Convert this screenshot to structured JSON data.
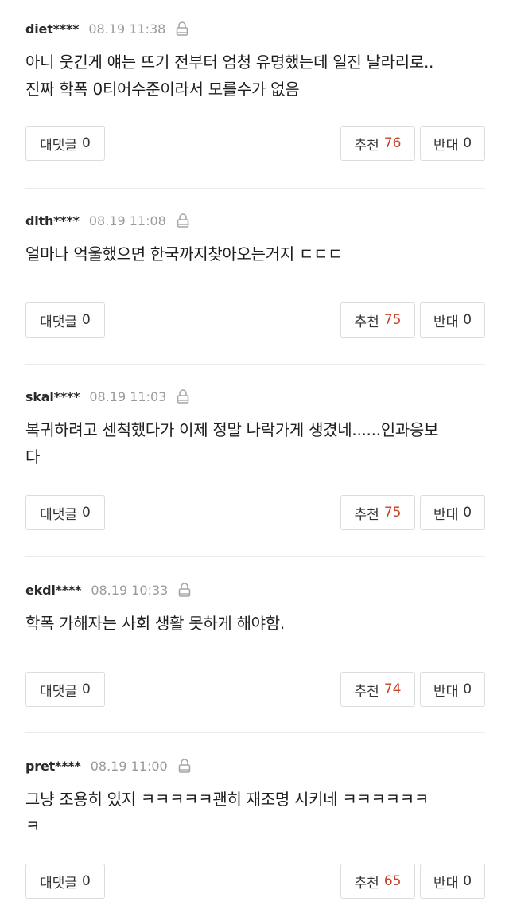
{
  "comments": [
    {
      "author": "diet****",
      "date": "08.19 11:38",
      "lines": [
        "아니 웃긴게 얘는 뜨기 전부터 엄청 유명했는데 일진 날라리로..",
        "진짜 학폭 0티어수준이라서 모를수가 없음"
      ],
      "reply_label": "대댓글",
      "reply_count": "0",
      "recommend_label": "추천",
      "recommend_count": "76",
      "oppose_label": "반대",
      "oppose_count": "0"
    },
    {
      "author": "dlth****",
      "date": "08.19 11:08",
      "lines": [
        "얼마나 억울했으면 한국까지찾아오는거지 ㄷㄷㄷ"
      ],
      "reply_label": "대댓글",
      "reply_count": "0",
      "recommend_label": "추천",
      "recommend_count": "75",
      "oppose_label": "반대",
      "oppose_count": "0"
    },
    {
      "author": "skal****",
      "date": "08.19 11:03",
      "lines": [
        "복귀하려고 센척했다가 이제 정말 나락가게 생겼네......인과응보",
        "다"
      ],
      "reply_label": "대댓글",
      "reply_count": "0",
      "recommend_label": "추천",
      "recommend_count": "75",
      "oppose_label": "반대",
      "oppose_count": "0"
    },
    {
      "author": "ekdl****",
      "date": "08.19 10:33",
      "lines": [
        "학폭 가해자는 사회 생활 못하게 해야함."
      ],
      "reply_label": "대댓글",
      "reply_count": "0",
      "recommend_label": "추천",
      "recommend_count": "74",
      "oppose_label": "반대",
      "oppose_count": "0"
    },
    {
      "author": "pret****",
      "date": "08.19 11:00",
      "lines": [
        "그냥 조용히 있지 ㅋㅋㅋㅋㅋ괜히 재조명 시키네 ㅋㅋㅋㅋㅋㅋ",
        "ㅋ"
      ],
      "reply_label": "대댓글",
      "reply_count": "0",
      "recommend_label": "추천",
      "recommend_count": "65",
      "oppose_label": "반대",
      "oppose_count": "0"
    }
  ],
  "colors": {
    "recommend_count": "#c8422a",
    "date": "#9a9a9a",
    "border": "#dcdcdc"
  },
  "icons": {
    "meta": "lock-icon"
  }
}
